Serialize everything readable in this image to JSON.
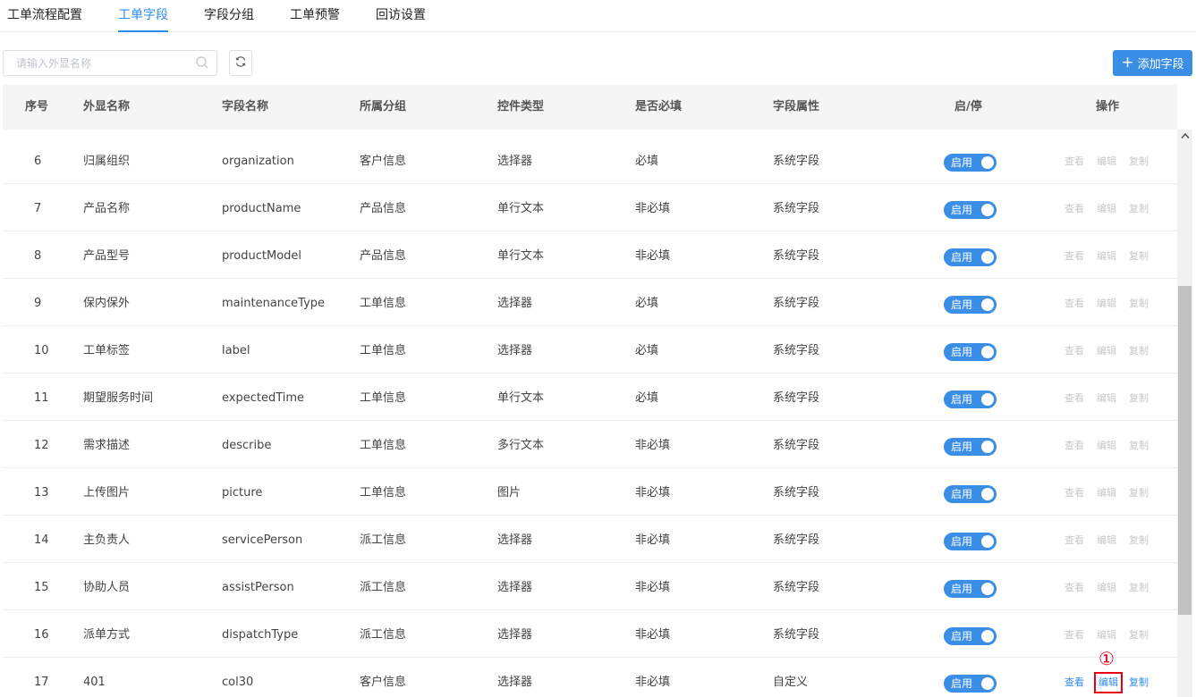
{
  "tabs": [
    {
      "label": "工单流程配置",
      "active": false
    },
    {
      "label": "工单字段",
      "active": true
    },
    {
      "label": "字段分组",
      "active": false
    },
    {
      "label": "工单预警",
      "active": false
    },
    {
      "label": "回访设置",
      "active": false
    }
  ],
  "toolbar": {
    "search_placeholder": "请输入外显名称",
    "add_label": "添加字段"
  },
  "table": {
    "headers": [
      "序号",
      "外显名称",
      "字段名称",
      "所属分组",
      "控件类型",
      "是否必填",
      "字段属性",
      "启/停",
      "操作"
    ],
    "rows": [
      {
        "no": "6",
        "display": "归属组织",
        "field": "organization",
        "group": "客户信息",
        "control": "选择器",
        "required": "必填",
        "attr": "系统字段",
        "status": "启用",
        "view": "查看",
        "edit": "编辑",
        "copy": "复制",
        "ops_enabled": false
      },
      {
        "no": "7",
        "display": "产品名称",
        "field": "productName",
        "group": "产品信息",
        "control": "单行文本",
        "required": "非必填",
        "attr": "系统字段",
        "status": "启用",
        "view": "查看",
        "edit": "编辑",
        "copy": "复制",
        "ops_enabled": false
      },
      {
        "no": "8",
        "display": "产品型号",
        "field": "productModel",
        "group": "产品信息",
        "control": "单行文本",
        "required": "非必填",
        "attr": "系统字段",
        "status": "启用",
        "view": "查看",
        "edit": "编辑",
        "copy": "复制",
        "ops_enabled": false
      },
      {
        "no": "9",
        "display": "保内保外",
        "field": "maintenanceType",
        "group": "工单信息",
        "control": "选择器",
        "required": "必填",
        "attr": "系统字段",
        "status": "启用",
        "view": "查看",
        "edit": "编辑",
        "copy": "复制",
        "ops_enabled": false
      },
      {
        "no": "10",
        "display": "工单标签",
        "field": "label",
        "group": "工单信息",
        "control": "选择器",
        "required": "必填",
        "attr": "系统字段",
        "status": "启用",
        "view": "查看",
        "edit": "编辑",
        "copy": "复制",
        "ops_enabled": false
      },
      {
        "no": "11",
        "display": "期望服务时间",
        "field": "expectedTime",
        "group": "工单信息",
        "control": "单行文本",
        "required": "必填",
        "attr": "系统字段",
        "status": "启用",
        "view": "查看",
        "edit": "编辑",
        "copy": "复制",
        "ops_enabled": false
      },
      {
        "no": "12",
        "display": "需求描述",
        "field": "describe",
        "group": "工单信息",
        "control": "多行文本",
        "required": "非必填",
        "attr": "系统字段",
        "status": "启用",
        "view": "查看",
        "edit": "编辑",
        "copy": "复制",
        "ops_enabled": false
      },
      {
        "no": "13",
        "display": "上传图片",
        "field": "picture",
        "group": "工单信息",
        "control": "图片",
        "required": "非必填",
        "attr": "系统字段",
        "status": "启用",
        "view": "查看",
        "edit": "编辑",
        "copy": "复制",
        "ops_enabled": false
      },
      {
        "no": "14",
        "display": "主负责人",
        "field": "servicePerson",
        "group": "派工信息",
        "control": "选择器",
        "required": "非必填",
        "attr": "系统字段",
        "status": "启用",
        "view": "查看",
        "edit": "编辑",
        "copy": "复制",
        "ops_enabled": false
      },
      {
        "no": "15",
        "display": "协助人员",
        "field": "assistPerson",
        "group": "派工信息",
        "control": "选择器",
        "required": "非必填",
        "attr": "系统字段",
        "status": "启用",
        "view": "查看",
        "edit": "编辑",
        "copy": "复制",
        "ops_enabled": false
      },
      {
        "no": "16",
        "display": "派单方式",
        "field": "dispatchType",
        "group": "派工信息",
        "control": "选择器",
        "required": "非必填",
        "attr": "系统字段",
        "status": "启用",
        "view": "查看",
        "edit": "编辑",
        "copy": "复制",
        "ops_enabled": false
      },
      {
        "no": "17",
        "display": "401",
        "field": "col30",
        "group": "客户信息",
        "control": "选择器",
        "required": "非必填",
        "attr": "自定义",
        "status": "启用",
        "view": "查看",
        "edit": "编辑",
        "copy": "复制",
        "ops_enabled": true,
        "highlight_edit": true
      }
    ]
  },
  "annotation": {
    "marker": "①",
    "color": "#e60012"
  },
  "colors": {
    "accent": "#2d8cf0",
    "button": "#3a8ee6",
    "disabled_op": "#c8c8c8"
  },
  "icons": {
    "search": "search-icon",
    "refresh": "refresh-icon",
    "add": "plus-icon",
    "scroll_up": "chevron-up-icon"
  }
}
